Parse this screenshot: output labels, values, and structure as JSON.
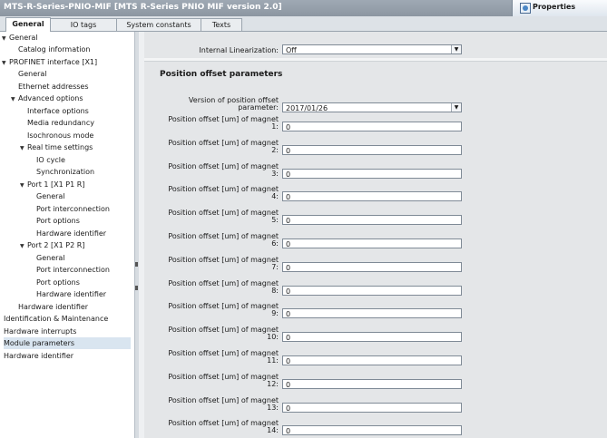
{
  "window": {
    "title": "MTS-R-Series-PNIO-MIF [MTS R-Series PNIO MIF version 2.0]",
    "properties_label": "Properties"
  },
  "tabs": [
    {
      "label": "General",
      "active": true
    },
    {
      "label": "IO tags",
      "active": false
    },
    {
      "label": "System constants",
      "active": false
    },
    {
      "label": "Texts",
      "active": false
    }
  ],
  "tree": [
    {
      "label": "General",
      "arrow": "▼"
    },
    {
      "label": "Catalog information",
      "arrow": ""
    },
    {
      "label": "PROFINET interface [X1]",
      "arrow": "▼"
    },
    {
      "label": "General",
      "arrow": ""
    },
    {
      "label": "Ethernet addresses",
      "arrow": ""
    },
    {
      "label": "Advanced options",
      "arrow": "▼"
    },
    {
      "label": "Interface options",
      "arrow": ""
    },
    {
      "label": "Media redundancy",
      "arrow": ""
    },
    {
      "label": "Isochronous mode",
      "arrow": ""
    },
    {
      "label": "Real time settings",
      "arrow": "▼"
    },
    {
      "label": "IO cycle",
      "arrow": ""
    },
    {
      "label": "Synchronization",
      "arrow": ""
    },
    {
      "label": "Port 1 [X1 P1 R]",
      "arrow": "▼"
    },
    {
      "label": "General",
      "arrow": ""
    },
    {
      "label": "Port interconnection",
      "arrow": ""
    },
    {
      "label": "Port options",
      "arrow": ""
    },
    {
      "label": "Hardware identifier",
      "arrow": ""
    },
    {
      "label": "Port 2 [X1 P2 R]",
      "arrow": "▼"
    },
    {
      "label": "General",
      "arrow": ""
    },
    {
      "label": "Port interconnection",
      "arrow": ""
    },
    {
      "label": "Port options",
      "arrow": ""
    },
    {
      "label": "Hardware identifier",
      "arrow": ""
    },
    {
      "label": "Hardware identifier",
      "arrow": ""
    },
    {
      "label": "Identification & Maintenance",
      "arrow": ""
    },
    {
      "label": "Hardware interrupts",
      "arrow": ""
    },
    {
      "label": "Module parameters",
      "arrow": "",
      "selected": true
    },
    {
      "label": "Hardware identifier",
      "arrow": ""
    }
  ],
  "content": {
    "linearization_label": "Internal Linearization:",
    "linearization_value": "Off",
    "section_title": "Position offset parameters",
    "version_label_1": "Version of position offset",
    "version_label_2": "parameter:",
    "version_value": "2017/01/26",
    "offset_label": "Position offset [um] of magnet",
    "offsets": [
      {
        "num": "1:",
        "value": "0"
      },
      {
        "num": "2:",
        "value": "0"
      },
      {
        "num": "3:",
        "value": "0"
      },
      {
        "num": "4:",
        "value": "0"
      },
      {
        "num": "5:",
        "value": "0"
      },
      {
        "num": "6:",
        "value": "0"
      },
      {
        "num": "7:",
        "value": "0"
      },
      {
        "num": "8:",
        "value": "0"
      },
      {
        "num": "9:",
        "value": "0"
      },
      {
        "num": "10:",
        "value": "0"
      },
      {
        "num": "11:",
        "value": "0"
      },
      {
        "num": "12:",
        "value": "0"
      },
      {
        "num": "13:",
        "value": "0"
      },
      {
        "num": "14:",
        "value": "0"
      }
    ]
  }
}
